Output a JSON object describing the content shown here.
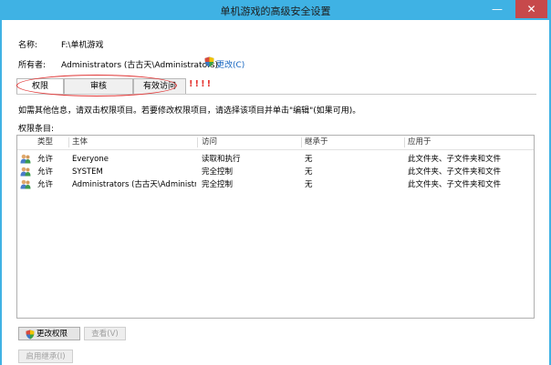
{
  "window": {
    "title": "单机游戏的高级安全设置",
    "minimize_glyph": "—",
    "close_glyph": "✕"
  },
  "info": {
    "name_label": "名称:",
    "name_value": "F:\\单机游戏",
    "owner_label": "所有者:",
    "owner_value": "Administrators (古古天\\Administrators)",
    "change_link": "更改(C)"
  },
  "tabs": [
    {
      "label": "权限",
      "active": true
    },
    {
      "label": "审核",
      "active": false
    },
    {
      "label": "有效访问",
      "active": false
    }
  ],
  "annotation": {
    "marks": "!!!!",
    "color": "#e53935"
  },
  "instructions": "如需其他信息，请双击权限项目。若要修改权限项目，请选择该项目并单击\"编辑\"(如果可用)。",
  "entries_label": "权限条目:",
  "table": {
    "columns": [
      "类型",
      "主体",
      "访问",
      "继承于",
      "应用于"
    ],
    "rows": [
      {
        "type": "允许",
        "principal": "Everyone",
        "access": "读取和执行",
        "inherited": "无",
        "applies": "此文件夹、子文件夹和文件"
      },
      {
        "type": "允许",
        "principal": "SYSTEM",
        "access": "完全控制",
        "inherited": "无",
        "applies": "此文件夹、子文件夹和文件"
      },
      {
        "type": "允许",
        "principal": "Administrators (古古天\\Administr...",
        "access": "完全控制",
        "inherited": "无",
        "applies": "此文件夹、子文件夹和文件"
      }
    ]
  },
  "buttons": {
    "change_permissions": "更改权限",
    "view": "查看(V)",
    "enable_inheritance": "启用继承(I)"
  },
  "colors": {
    "titlebar": "#3fb2e4",
    "close": "#c7494b",
    "accent_link": "#1565c0"
  }
}
